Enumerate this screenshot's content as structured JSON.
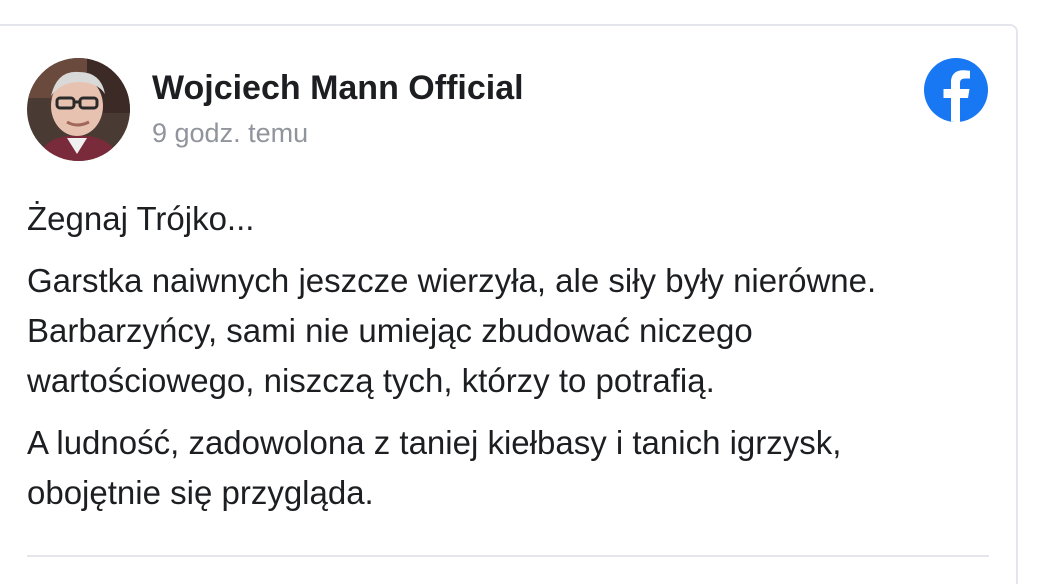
{
  "post": {
    "author": "Wojciech Mann Official",
    "timestamp": "9 godz. temu",
    "logo_icon": "facebook-icon",
    "paragraphs": [
      [
        "Żegnaj Trójko..."
      ],
      [
        "Garstka naiwnych jeszcze wierzyła, ale siły były nierówne.",
        "Barbarzyńcy, sami nie umiejąc zbudować niczego",
        "wartościowego, niszczą tych, którzy to potrafią."
      ],
      [
        "A ludność, zadowolona z taniej kiełbasy i tanich igrzysk,",
        "obojętnie się przygląda."
      ]
    ]
  },
  "colors": {
    "facebook_blue": "#1877f2",
    "author_text": "#1c1e21",
    "timestamp_text": "#90949c",
    "border": "#e4e6eb"
  }
}
